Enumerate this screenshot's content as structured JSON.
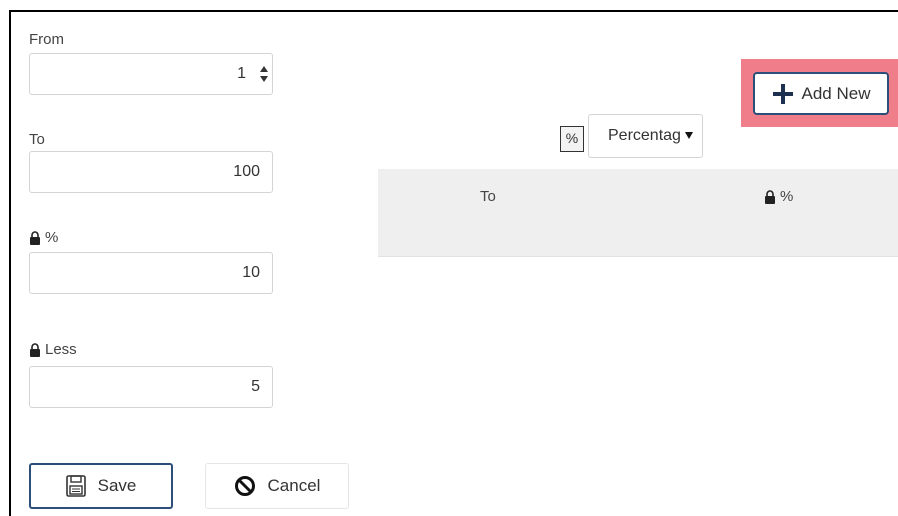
{
  "form": {
    "from": {
      "label": "From",
      "value": "1"
    },
    "to": {
      "label": "To",
      "value": "100"
    },
    "percent": {
      "label": "%",
      "value": "10"
    },
    "less": {
      "label": "Less",
      "value": "5"
    }
  },
  "buttons": {
    "save_label": "Save",
    "cancel_label": "Cancel",
    "add_new_label": "Add New"
  },
  "type_select": {
    "icon_text": "%",
    "selected": "Percentag"
  },
  "grid": {
    "columns": [
      "To",
      "%"
    ]
  },
  "colors": {
    "accent_border": "#2c4f7a",
    "highlight": "#f07d8a",
    "grid_header_bg": "#efefef"
  },
  "icons": {
    "lock": "lock-icon",
    "save": "floppy-disk-icon",
    "cancel": "ban-icon",
    "add": "plus-icon"
  }
}
